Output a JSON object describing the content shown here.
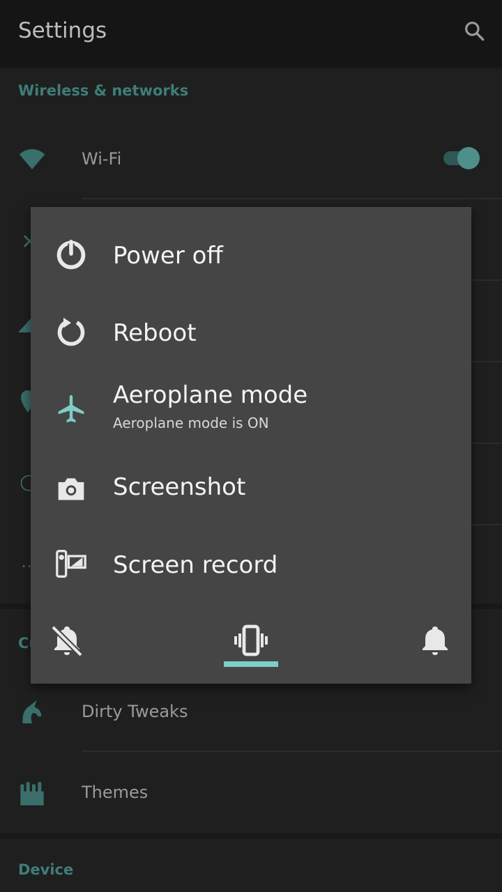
{
  "appbar": {
    "title": "Settings",
    "search_icon": "search-icon"
  },
  "sections": {
    "wireless": "Wireless & networks",
    "customization": "Cu",
    "device": "Device"
  },
  "rows": {
    "wifi": {
      "label": "Wi-Fi",
      "icon": "wifi-icon",
      "toggle_on": true
    },
    "dirty_tweaks": {
      "label": "Dirty Tweaks",
      "icon": "unicorn-icon"
    },
    "themes": {
      "label": "Themes",
      "icon": "themes-icon"
    }
  },
  "power_menu": {
    "items": [
      {
        "label": "Power off",
        "icon": "power-icon"
      },
      {
        "label": "Reboot",
        "icon": "reboot-icon"
      },
      {
        "label": "Aeroplane mode",
        "sublabel": "Aeroplane mode is ON",
        "icon": "airplane-icon"
      },
      {
        "label": "Screenshot",
        "icon": "camera-icon"
      },
      {
        "label": "Screen record",
        "icon": "screen-record-icon"
      }
    ],
    "sound_modes": [
      "silent",
      "vibrate",
      "sound"
    ],
    "selected_sound_mode": "vibrate"
  },
  "colors": {
    "accent": "#7ecdc7",
    "dim_accent": "#3f7d78",
    "dialog_bg": "#454545"
  }
}
